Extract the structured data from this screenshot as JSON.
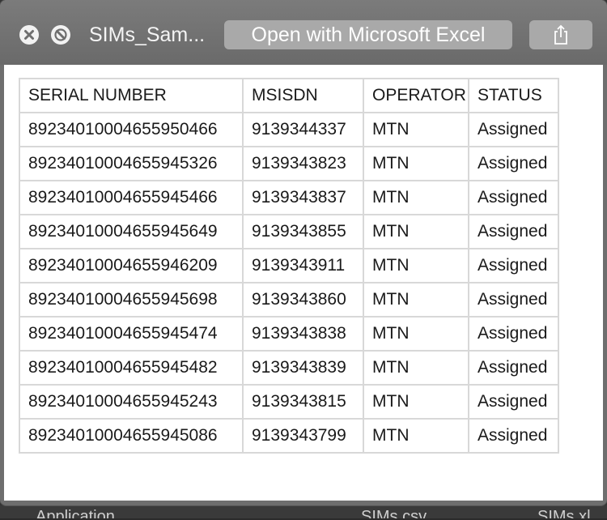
{
  "window": {
    "file_title": "SIMs_Sam...",
    "open_button_label": "Open with Microsoft Excel"
  },
  "icons": {
    "close": "close-icon",
    "stop": "stop-icon",
    "share": "share-icon"
  },
  "table": {
    "headers": [
      "SERIAL NUMBER",
      "MSISDN",
      "OPERATOR",
      "STATUS"
    ],
    "rows": [
      [
        "89234010004655950466",
        "9139344337",
        "MTN",
        "Assigned"
      ],
      [
        "89234010004655945326",
        "9139343823",
        "MTN",
        "Assigned"
      ],
      [
        "89234010004655945466",
        "9139343837",
        "MTN",
        "Assigned"
      ],
      [
        "89234010004655945649",
        "9139343855",
        "MTN",
        "Assigned"
      ],
      [
        "89234010004655946209",
        "9139343911",
        "MTN",
        "Assigned"
      ],
      [
        "89234010004655945698",
        "9139343860",
        "MTN",
        "Assigned"
      ],
      [
        "89234010004655945474",
        "9139343838",
        "MTN",
        "Assigned"
      ],
      [
        "89234010004655945482",
        "9139343839",
        "MTN",
        "Assigned"
      ],
      [
        "89234010004655945243",
        "9139343815",
        "MTN",
        "Assigned"
      ],
      [
        "89234010004655945086",
        "9139343799",
        "MTN",
        "Assigned"
      ]
    ]
  },
  "background": {
    "item1": "Application",
    "item2": "SIMs.csv",
    "item3": "SIMs.xl"
  },
  "colors": {
    "titlebar": "#6e6e6e",
    "button": "#a9a9a9",
    "grid": "#d8d8d8"
  }
}
